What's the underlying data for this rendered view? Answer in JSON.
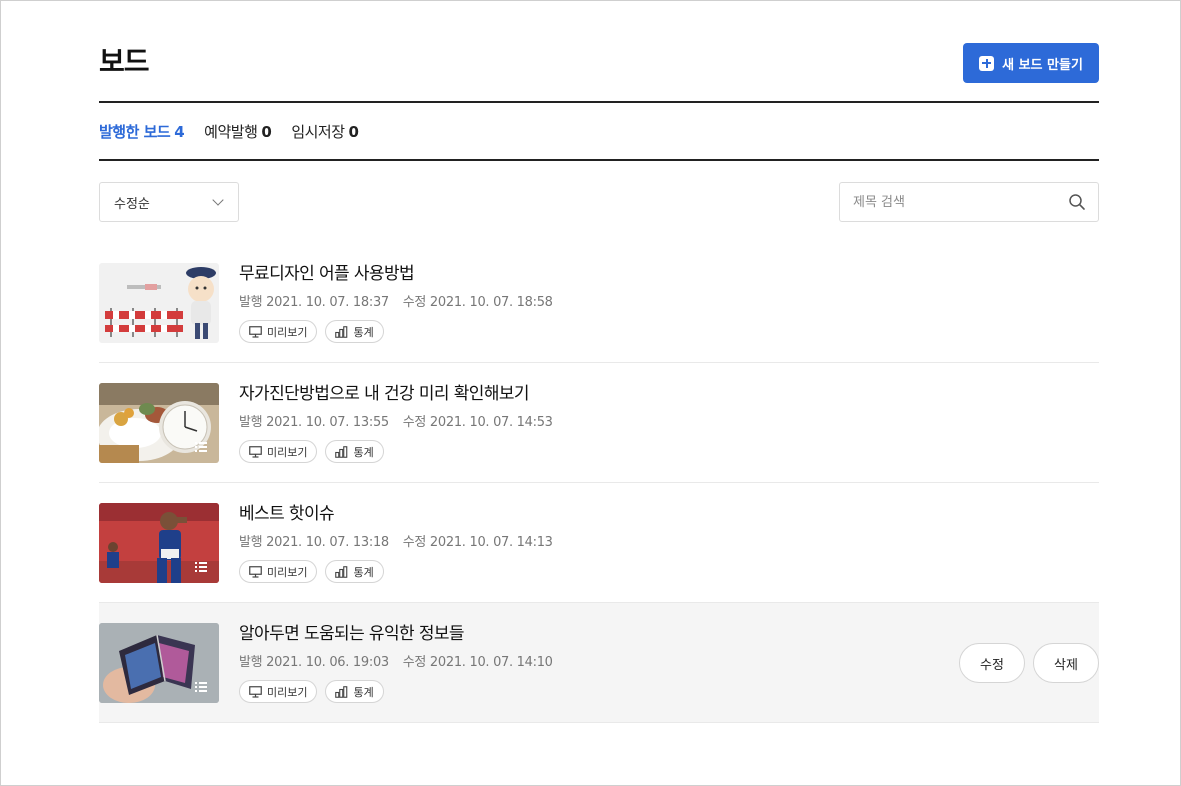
{
  "page": {
    "title": "보드",
    "new_button_label": "새 보드 만들기"
  },
  "tabs": [
    {
      "label": "발행한 보드",
      "count": "4",
      "active": true
    },
    {
      "label": "예약발행",
      "count": "0",
      "active": false
    },
    {
      "label": "임시저장",
      "count": "0",
      "active": false
    }
  ],
  "toolbar": {
    "sort_selected": "수정순",
    "search_placeholder": "제목 검색"
  },
  "labels": {
    "published": "발행",
    "modified": "수정",
    "preview": "미리보기",
    "stats": "통계",
    "edit": "수정",
    "delete": "삭제"
  },
  "boards": [
    {
      "title": "무료디자인 어플 사용방법",
      "published": "2021. 10. 07. 18:37",
      "modified": "2021. 10. 07. 18:58",
      "thumb": "police-character-barricade"
    },
    {
      "title": "자가진단방법으로 내 건강 미리 확인해보기",
      "published": "2021. 10. 07. 13:55",
      "modified": "2021. 10. 07. 14:53",
      "thumb": "breakfast-plate-clock"
    },
    {
      "title": "베스트 핫이슈",
      "published": "2021. 10. 07. 13:18",
      "modified": "2021. 10. 07. 14:13",
      "thumb": "athlete-saluting"
    },
    {
      "title": "알아두면 도움되는 유익한 정보들",
      "published": "2021. 10. 06. 19:03",
      "modified": "2021. 10. 07. 14:10",
      "thumb": "foldable-phone-in-hand"
    }
  ]
}
